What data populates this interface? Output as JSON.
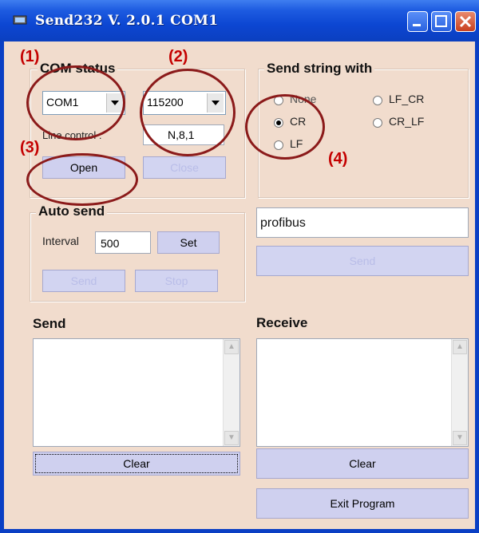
{
  "window": {
    "title": "Send232  V. 2.0.1  COM1"
  },
  "com_status": {
    "title": "COM status",
    "port_value": "COM1",
    "baud_value": "115200",
    "line_control_label": "Line control :",
    "line_control_value": "N,8,1",
    "open_label": "Open",
    "close_label": "Close"
  },
  "send_string": {
    "title": "Send string with",
    "options": [
      "None",
      "CR",
      "LF",
      "LF_CR",
      "CR_LF"
    ],
    "selected": "CR"
  },
  "auto_send": {
    "title": "Auto send",
    "interval_label": "Interval",
    "interval_value": "500",
    "set_label": "Set",
    "send_label": "Send",
    "stop_label": "Stop"
  },
  "send_text": {
    "value": "profibus",
    "send_label": "Send"
  },
  "send_panel": {
    "title": "Send",
    "clear_label": "Clear"
  },
  "receive_panel": {
    "title": "Receive",
    "clear_label": "Clear"
  },
  "exit_label": "Exit Program",
  "annotations": [
    "(1)",
    "(2)",
    "(3)",
    "(4)"
  ],
  "colors": {
    "annotation": "#c40000",
    "circle": "#8b1a1a",
    "client_bg": "#f1dccd",
    "button_bg": "#cfd0ef"
  }
}
